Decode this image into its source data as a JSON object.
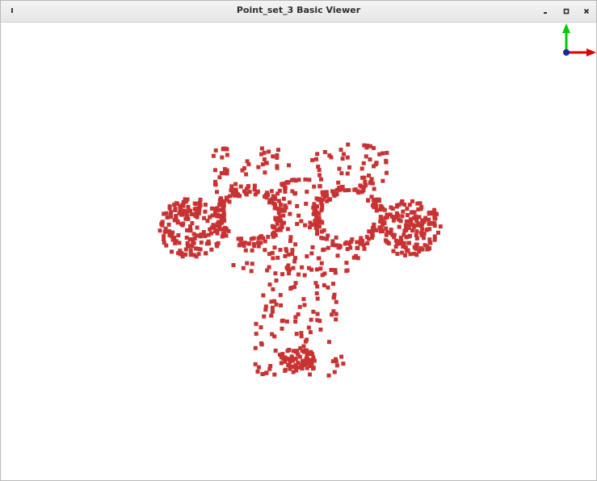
{
  "window": {
    "title": "Point_set_3 Basic Viewer",
    "buttons": [
      "window-menu",
      "minimize",
      "maximize",
      "close"
    ]
  },
  "viewer": {
    "background": "#ffffff",
    "point_color": "#c83232",
    "axes": {
      "x_color": "#dd0000",
      "y_color": "#00cc00",
      "origin_color": "#1a2a9a"
    }
  }
}
